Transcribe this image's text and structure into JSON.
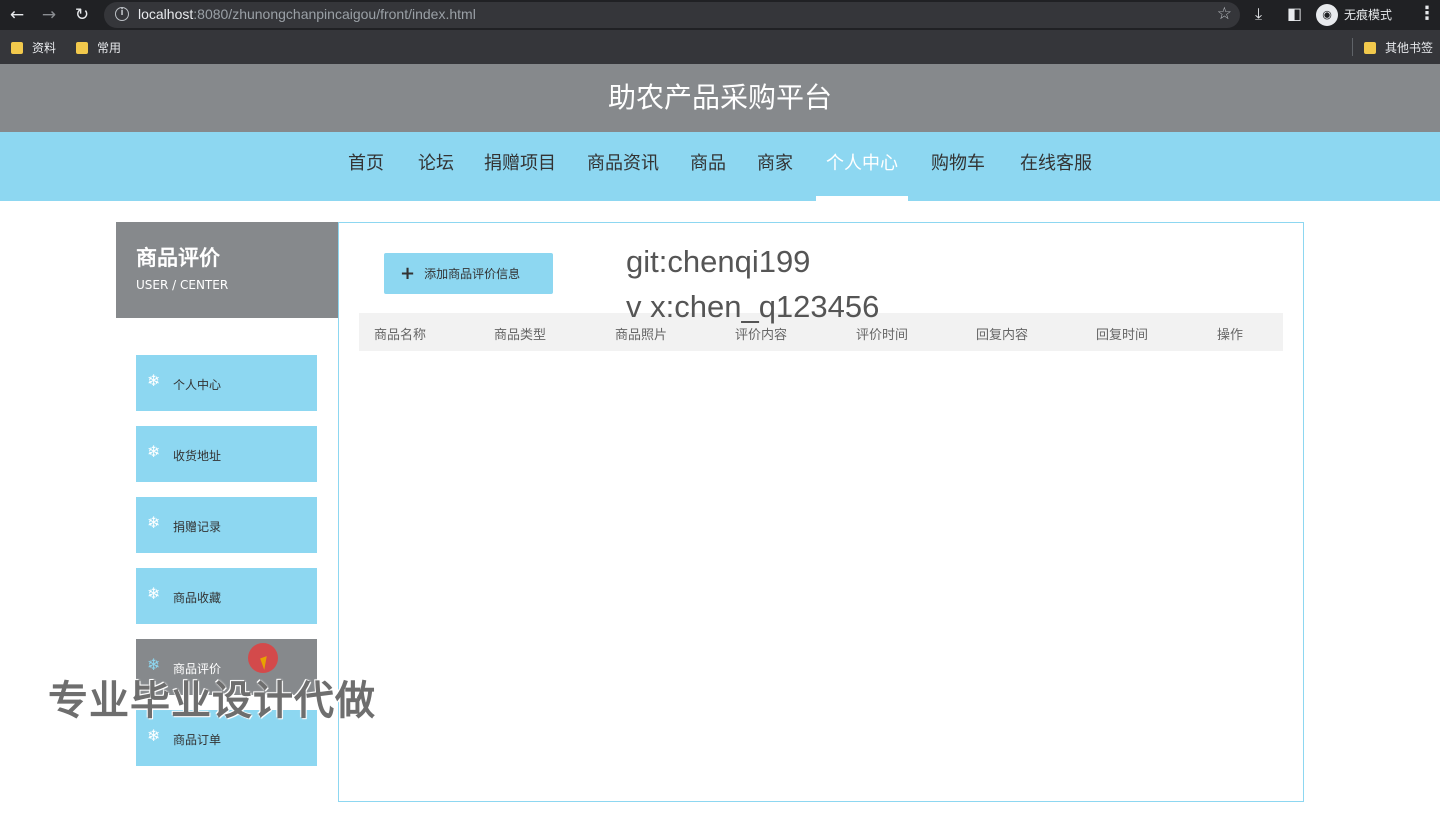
{
  "browser": {
    "url_host": "localhost",
    "url_rest": ":8080/zhunongchanpincaigou/front/index.html",
    "incognito_label": "无痕模式",
    "bookmarks": [
      "资料",
      "常用"
    ],
    "other_bookmarks": "其他书签"
  },
  "site": {
    "title": "助农产品采购平台",
    "nav": [
      "首页",
      "论坛",
      "捐赠项目",
      "商品资讯",
      "商品",
      "商家",
      "个人中心",
      "购物车",
      "在线客服"
    ],
    "active_nav": "个人中心"
  },
  "sidebar": {
    "title": "商品评价",
    "subtitle": "USER / CENTER",
    "items": [
      "个人中心",
      "收货地址",
      "捐赠记录",
      "商品收藏",
      "商品评价",
      "商品订单"
    ],
    "active_item": "商品评价"
  },
  "main": {
    "add_button": "添加商品评价信息",
    "columns": [
      "商品名称",
      "商品类型",
      "商品照片",
      "评价内容",
      "评价时间",
      "回复内容",
      "回复时间",
      "操作"
    ]
  },
  "overlays": {
    "git": "git:chenqi199",
    "vx": "v x:chen_q123456",
    "cn": "专业毕业设计代做"
  },
  "colors": {
    "header_gray": "#86898c",
    "nav_blue": "#8dd7f1"
  }
}
